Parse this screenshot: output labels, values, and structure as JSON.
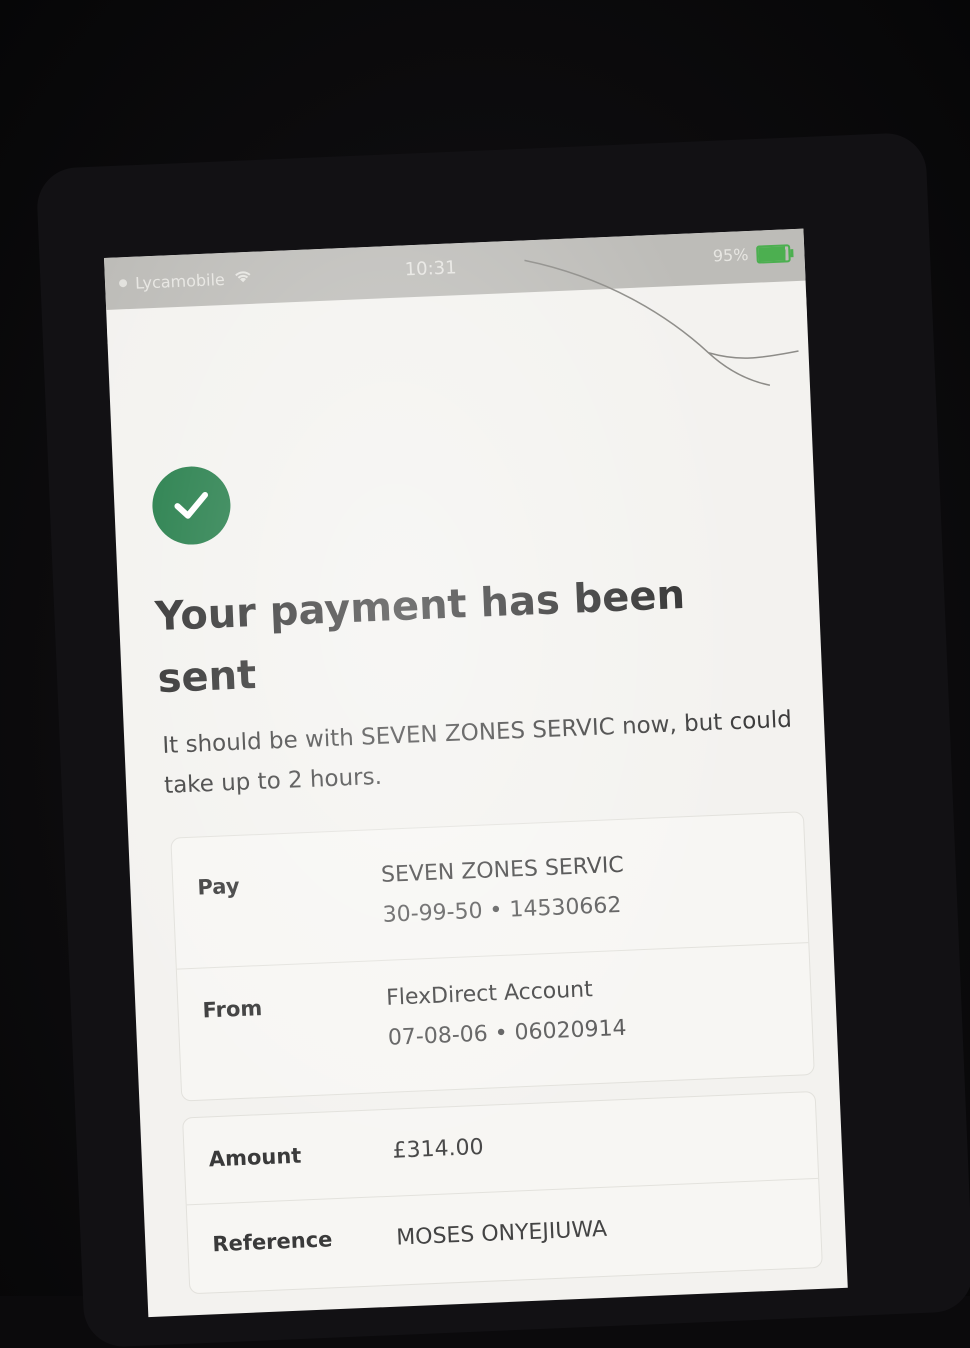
{
  "status_bar": {
    "carrier": "Lycamobile",
    "time": "10:31",
    "battery": "95%"
  },
  "confirmation": {
    "title": "Your payment has been sent",
    "message": "It should be with SEVEN ZONES SERVIC now, but could take up to 2 hours."
  },
  "details": {
    "pay": {
      "label": "Pay",
      "name": "SEVEN ZONES SERVIC",
      "account": "30-99-50 • 14530662"
    },
    "from": {
      "label": "From",
      "name": "FlexDirect Account",
      "account": "07-08-06 • 06020914"
    },
    "amount": {
      "label": "Amount",
      "value": "£314.00"
    },
    "reference": {
      "label": "Reference",
      "value": "MOSES ONYEJIUWA"
    }
  },
  "colors": {
    "success_green": "#1f7a45",
    "battery_green": "#4caf50"
  }
}
